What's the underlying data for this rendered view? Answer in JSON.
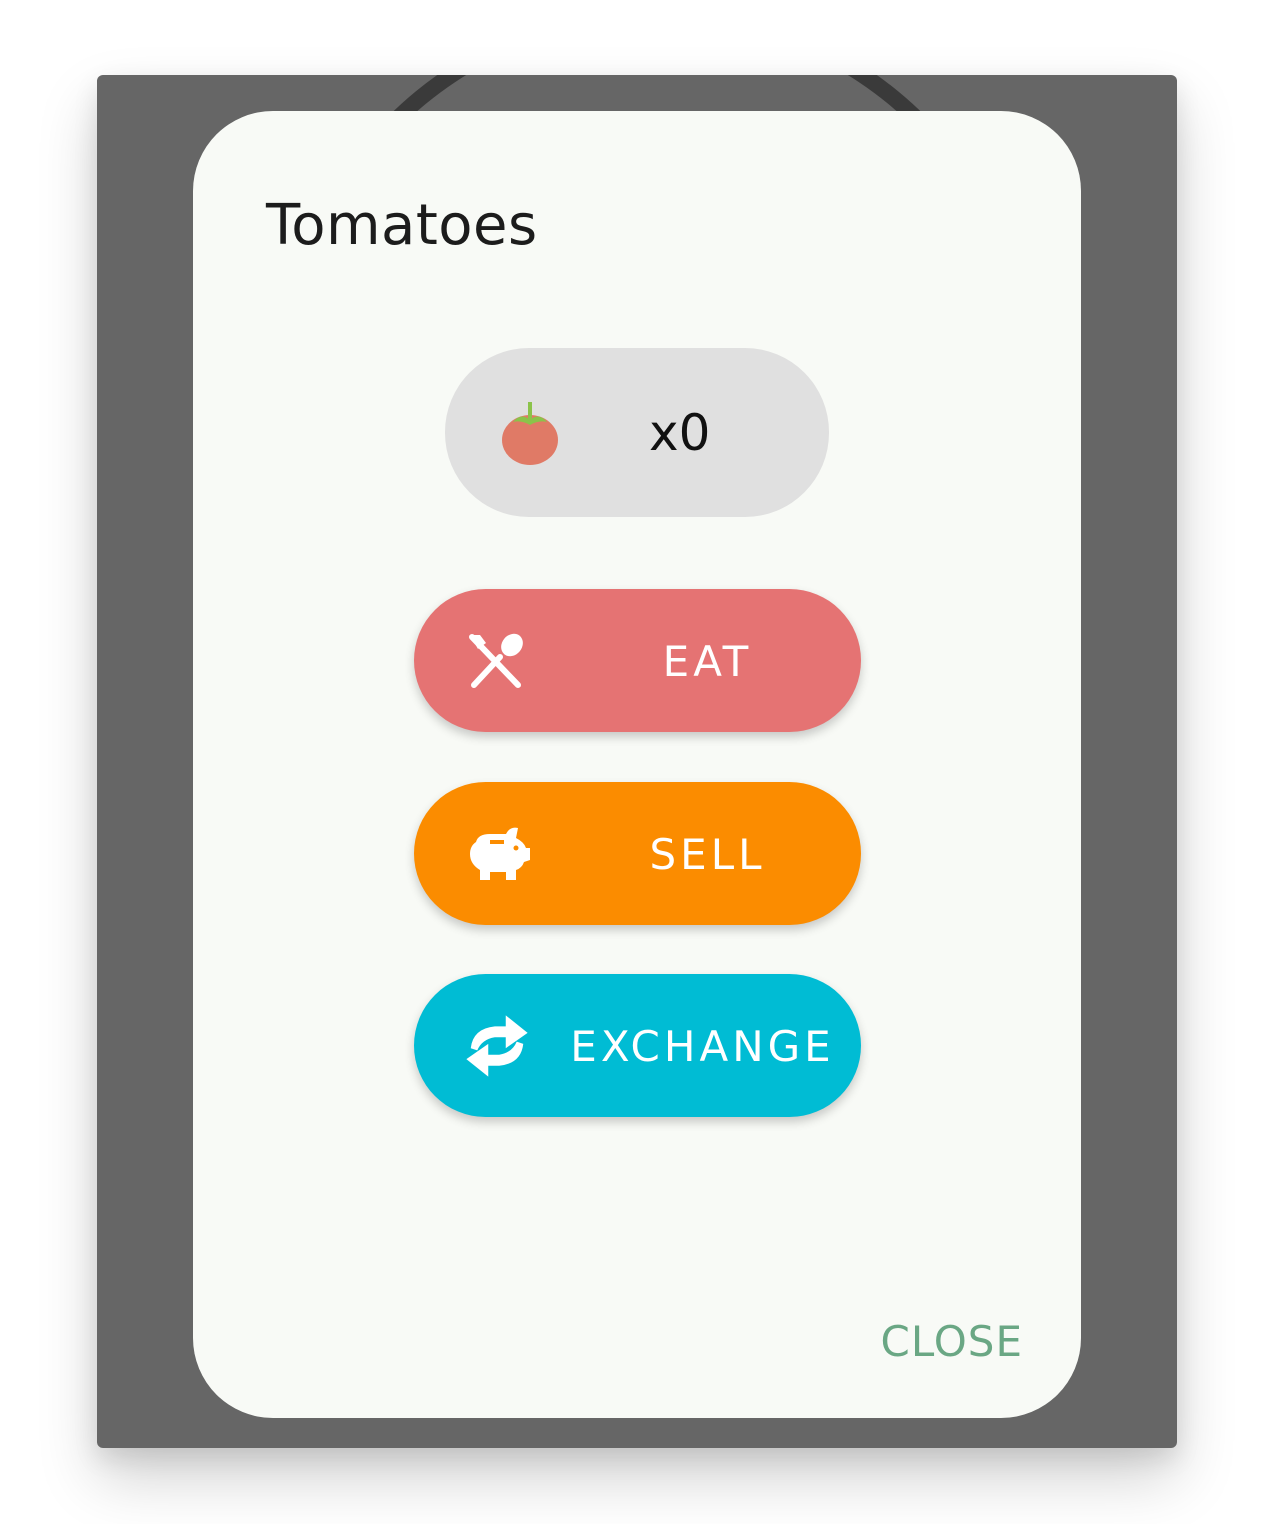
{
  "dialog": {
    "title": "Tomatoes",
    "item_icon": "tomato-icon",
    "count": "x0",
    "actions": [
      {
        "label": "EAT",
        "icon": "fork-spoon-icon",
        "color": "#e57373"
      },
      {
        "label": "SELL",
        "icon": "piggy-bank-icon",
        "color": "#fb8c00"
      },
      {
        "label": "EXCHANGE",
        "icon": "exchange-arrows-icon",
        "color": "#00bcd4"
      }
    ],
    "close_label": "CLOSE"
  },
  "colors": {
    "backdrop": "#666666",
    "dialog_background": "#f8faf6",
    "count_pill": "#e0e0e0",
    "close_text": "#6aa784",
    "tomato": "#e07a66",
    "tomato_stem": "#8bc34a"
  }
}
